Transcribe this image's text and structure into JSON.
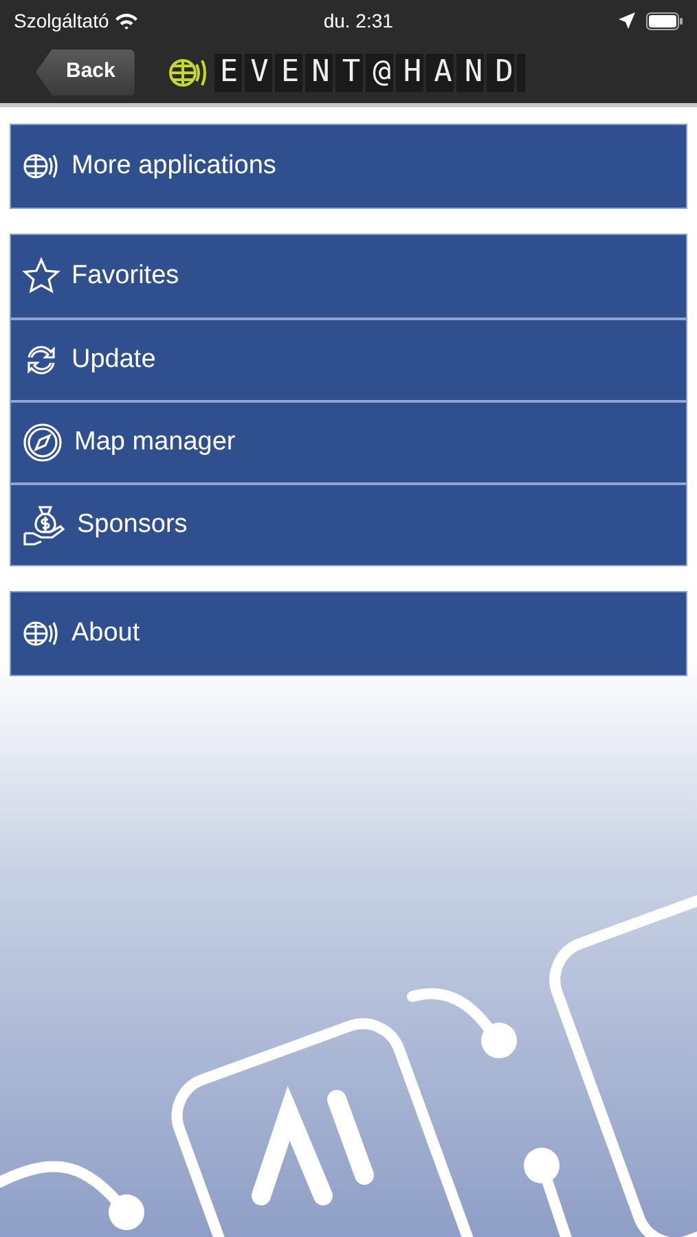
{
  "status_bar": {
    "carrier": "Szolgáltató",
    "time": "du. 2:31"
  },
  "nav_bar": {
    "back_button": "Back",
    "title": "EVENT@HAND"
  },
  "menu_groups": [
    {
      "items": [
        {
          "label": "More applications",
          "kind": "globe"
        }
      ]
    },
    {
      "items": [
        {
          "label": "Favorites",
          "kind": "star"
        },
        {
          "label": "Update",
          "kind": "sync"
        },
        {
          "label": "Map manager",
          "kind": "compass"
        },
        {
          "label": "Sponsors",
          "kind": "moneybag"
        }
      ]
    },
    {
      "items": [
        {
          "label": "About",
          "kind": "globe"
        }
      ]
    }
  ]
}
